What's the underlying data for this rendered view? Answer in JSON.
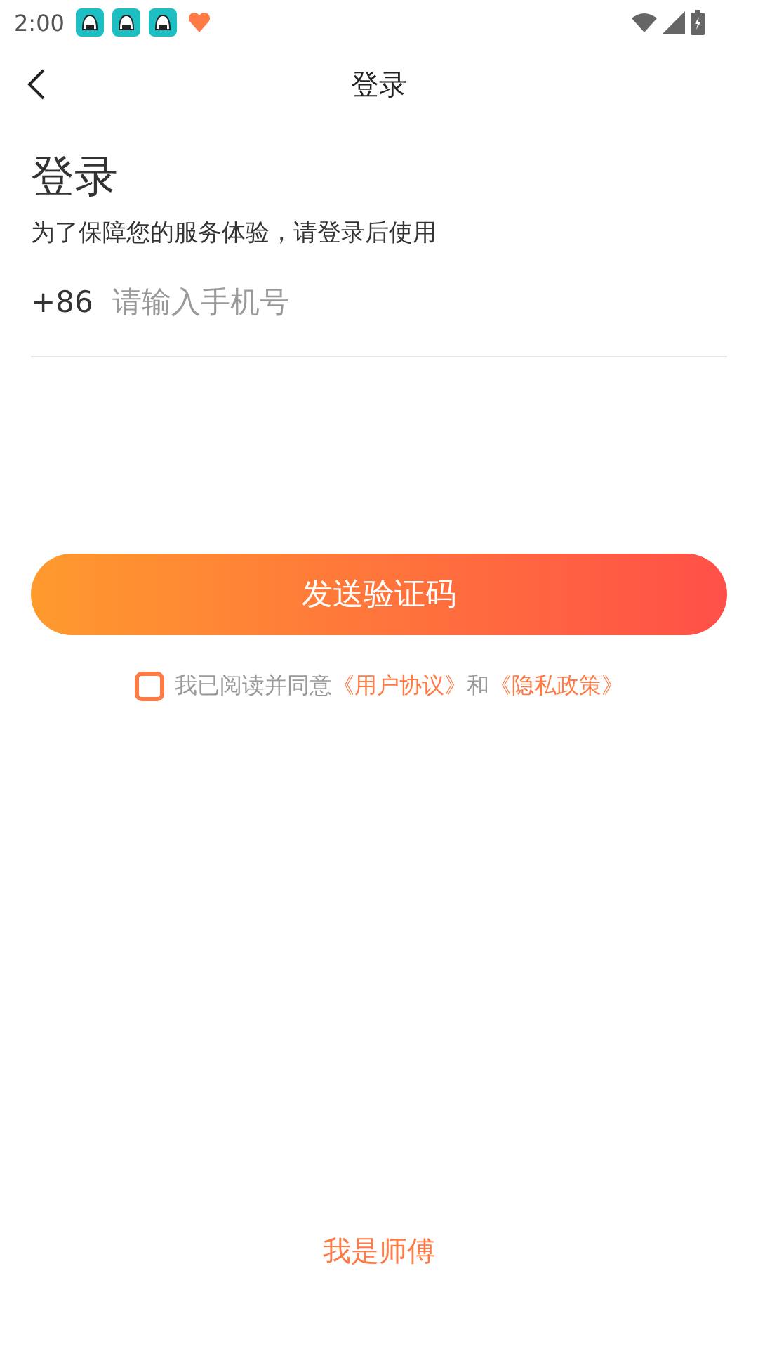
{
  "status_bar": {
    "time": "2:00",
    "notification_icons": [
      {
        "kind": "app"
      },
      {
        "kind": "app"
      },
      {
        "kind": "app"
      },
      {
        "kind": "heart"
      }
    ]
  },
  "nav_bar": {
    "title": "登录"
  },
  "heading": "登录",
  "subtitle": "为了保障您的服务体验，请登录后使用",
  "phone": {
    "country_code": "+86",
    "placeholder": "请输入手机号"
  },
  "send_button": "发送验证码",
  "agreement": {
    "checked": false,
    "parts": [
      {
        "kind": "text",
        "text": "我已阅读并同意"
      },
      {
        "kind": "link",
        "text": "《用户协议》"
      },
      {
        "kind": "text",
        "text": "和"
      },
      {
        "kind": "link",
        "text": "《隐私政策》"
      }
    ]
  },
  "bottom_link": "我是师傅"
}
